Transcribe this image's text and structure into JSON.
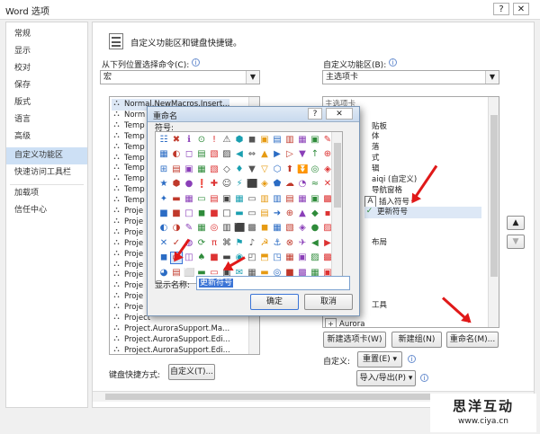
{
  "window": {
    "title": "Word 选项",
    "help": "?",
    "close": "✕"
  },
  "sidebar": {
    "items": [
      {
        "label": "常规"
      },
      {
        "label": "显示"
      },
      {
        "label": "校对"
      },
      {
        "label": "保存"
      },
      {
        "label": "版式"
      },
      {
        "label": "语言"
      },
      {
        "label": "高级"
      },
      {
        "label": "自定义功能区",
        "selected": true
      },
      {
        "label": "快速访问工具栏"
      },
      {
        "label": "加载项"
      },
      {
        "label": "信任中心"
      }
    ]
  },
  "main": {
    "header": "自定义功能区和键盘快捷键。",
    "left_label": "从下列位置选择命令(C):",
    "left_value": "宏",
    "right_label": "自定义功能区(B):",
    "right_value": "主选项卡",
    "macros": [
      "Normal.NewMacros.Insert...",
      "Norm",
      "Temp",
      "Temp",
      "Temp",
      "Temp",
      "Temp",
      "Temp",
      "Temp",
      "Temp",
      "Proje",
      "Proje",
      "Proje",
      "Proje",
      "Proje",
      "Proje",
      "Proje",
      "Proje",
      "Proje",
      "Proje",
      "Project",
      "Project.AuroraSupport.Ma...",
      "Project.AuroraSupport.Edi...",
      "Project.AuroraSupport.Edi..."
    ],
    "tree": [
      {
        "text": "主选项卡"
      },
      {
        "text": "贴板"
      },
      {
        "text": "体"
      },
      {
        "text": "落"
      },
      {
        "text": "式"
      },
      {
        "text": "辑"
      },
      {
        "text": "aiqi (自定义)"
      },
      {
        "text": "导航窗格"
      },
      {
        "text": "插入符号"
      },
      {
        "text": "更新符号"
      },
      {
        "text": "布局"
      },
      {
        "text": "工具"
      },
      {
        "text": "Aurora"
      }
    ],
    "new_tab_btn": "新建选项卡(W)",
    "new_group_btn": "新建组(N)",
    "rename_btn": "重命名(M)...",
    "customize_label": "自定义:",
    "reset_btn": "重置(E) ▾",
    "import_btn": "导入/导出(P) ▾",
    "kb_label": "键盘快捷方式:",
    "kb_btn": "自定义(T)..."
  },
  "dialog": {
    "title": "重命名",
    "help": "?",
    "close": "✕",
    "symbol_label": "符号:",
    "name_label": "显示名称:",
    "name_value": "更新符号",
    "ok": "确定",
    "cancel": "取消",
    "symbols": [
      "☷",
      "✖",
      "ℹ",
      "⊙",
      "!",
      "⚠",
      "⬢",
      "◼",
      "▣",
      "▤",
      "▥",
      "▦",
      "▣",
      "✎",
      "▦",
      "◐",
      "◻",
      "▤",
      "▧",
      "▨",
      "◀",
      "⇔",
      "▲",
      "▶",
      "▷",
      "▼",
      "↑",
      "⊕",
      "⊞",
      "▤",
      "▣",
      "▦",
      "▧",
      "◇",
      "♦",
      "▼",
      "▽",
      "⬡",
      "⬆",
      "⏬",
      "◎",
      "◈",
      "★",
      "⬢",
      "●",
      "❗",
      "✚",
      "☺",
      "⚡",
      "⬛",
      "◈",
      "⬟",
      "☁",
      "◔",
      "≈",
      "✕",
      "✦",
      "▬",
      "▦",
      "▭",
      "▤",
      "▣",
      "▦",
      "▭",
      "▥",
      "▥",
      "▤",
      "▦",
      "▣",
      "▩",
      "■",
      "■",
      "□",
      "◼",
      "■",
      "□",
      "▬",
      "▭",
      "▤",
      "➜",
      "⊕",
      "▲",
      "◆",
      "▪",
      "◐",
      "◑",
      "✎",
      "▦",
      "◎",
      "▥",
      "⬛",
      "▩",
      "◼",
      "▦",
      "▧",
      "◈",
      "●",
      "▨",
      "✕",
      "✓",
      "◍",
      "⟳",
      "π",
      "⌘",
      "⚑",
      "♪",
      "☭",
      "⚓",
      "⊗",
      "✈",
      "◀",
      "▶",
      "◼",
      "▭",
      "◫",
      "♠",
      "■",
      "▬",
      "◉",
      "◰",
      "⬒",
      "◳",
      "▦",
      "▣",
      "▨",
      "▩",
      "◕",
      "▤",
      "⬜",
      "▬",
      "▭",
      "▣",
      "✉",
      "▦",
      "▬",
      "◎",
      "■",
      "▩",
      "▦",
      "▣"
    ]
  },
  "watermark": {
    "brand": "思洋互动",
    "url": "www.ciya.cn"
  }
}
